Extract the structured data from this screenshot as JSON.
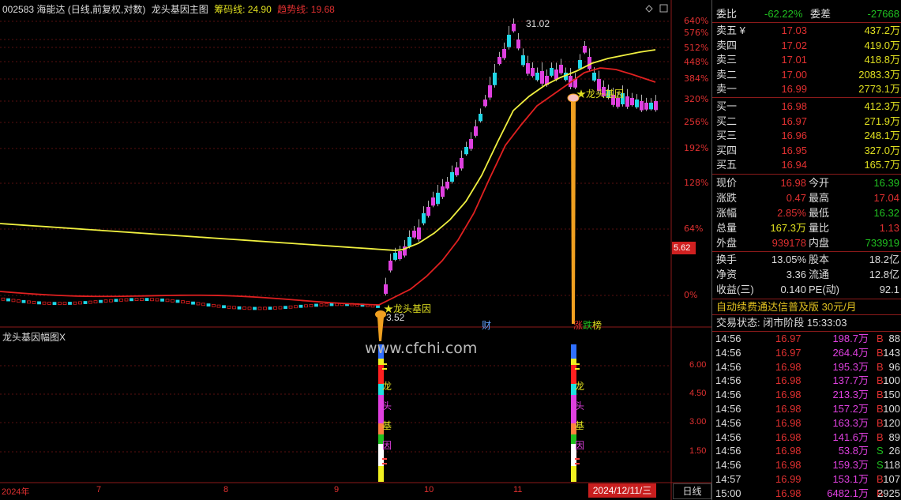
{
  "header": {
    "code_name": "002583 海能达 (日线,前复权,对数)",
    "indicator": "龙头基因主图",
    "chip_label": "筹码线: 24.90",
    "trend_label": "趋势线: 19.68"
  },
  "indicator_pane": {
    "title": "龙头基因幅图X"
  },
  "annotations": {
    "peak": "31.02",
    "low": "3.52",
    "gene1": "★龙头基因",
    "gene2": "★龙头基因",
    "cai": "财",
    "zhang": "涨",
    "die": "跌",
    "bang": "榜",
    "vchars": [
      "龙",
      "头",
      "基",
      "因"
    ]
  },
  "watermark": "www.cfchi.com",
  "y_axis": [
    "640%",
    "576%",
    "512%",
    "448%",
    "384%",
    "320%",
    "256%",
    "192%",
    "128%",
    "64%",
    "0%"
  ],
  "y_axis2": [
    "6.00",
    "4.50",
    "3.00",
    "1.50"
  ],
  "x_axis": [
    "2024年",
    "7",
    "8",
    "9",
    "10",
    "11"
  ],
  "current_price_tag": "5.62",
  "date_box": "2024/12/11/三",
  "period_button": "日线",
  "colors": {
    "up": "#e040e0",
    "down": "#20d8e8",
    "yellow": "#f0f040",
    "red": "#e02020"
  },
  "panel": {
    "weibi": {
      "label": "委比",
      "value": "-62.22%",
      "label2": "委差",
      "value2": "-27668"
    },
    "asks": [
      {
        "label": "卖五 ¥",
        "price": "17.03",
        "vol": "437.2万"
      },
      {
        "label": "卖四",
        "price": "17.02",
        "vol": "419.0万"
      },
      {
        "label": "卖三",
        "price": "17.01",
        "vol": "418.8万"
      },
      {
        "label": "卖二",
        "price": "17.00",
        "vol": "2083.3万"
      },
      {
        "label": "卖一",
        "price": "16.99",
        "vol": "2773.1万"
      }
    ],
    "bids": [
      {
        "label": "买一",
        "price": "16.98",
        "vol": "412.3万"
      },
      {
        "label": "买二",
        "price": "16.97",
        "vol": "271.9万"
      },
      {
        "label": "买三",
        "price": "16.96",
        "vol": "248.1万"
      },
      {
        "label": "买四",
        "price": "16.95",
        "vol": "327.0万"
      },
      {
        "label": "买五",
        "price": "16.94",
        "vol": "165.7万"
      }
    ],
    "quote": [
      {
        "l1": "现价",
        "v1": "16.98",
        "c1": "red",
        "l2": "今开",
        "v2": "16.39",
        "c2": "grn"
      },
      {
        "l1": "涨跌",
        "v1": "0.47",
        "c1": "red",
        "l2": "最高",
        "v2": "17.04",
        "c2": "red"
      },
      {
        "l1": "涨幅",
        "v1": "2.85%",
        "c1": "red",
        "l2": "最低",
        "v2": "16.32",
        "c2": "grn"
      },
      {
        "l1": "总量",
        "v1": "167.3万",
        "c1": "yel",
        "l2": "量比",
        "v2": "1.13",
        "c2": "red"
      },
      {
        "l1": "外盘",
        "v1": "939178",
        "c1": "red",
        "l2": "内盘",
        "v2": "733919",
        "c2": "grn"
      }
    ],
    "fundamentals": [
      {
        "l1": "换手",
        "v1": "13.05%",
        "l2": "股本",
        "v2": "18.2亿"
      },
      {
        "l1": "净资",
        "v1": "3.36",
        "l2": "流通",
        "v2": "12.8亿"
      },
      {
        "l1": "收益(三)",
        "v1": "0.140",
        "l2": "PE(动)",
        "v2": "92.1"
      }
    ],
    "promo": "自动续费通达信普及版  30元/月",
    "status": "交易状态: 闭市阶段 15:33:03",
    "ticks": [
      {
        "t": "14:56",
        "p": "16.97",
        "v": "198.7万",
        "d": "B",
        "n": "88"
      },
      {
        "t": "14:56",
        "p": "16.97",
        "v": "264.4万",
        "d": "B",
        "n": "143"
      },
      {
        "t": "14:56",
        "p": "16.98",
        "v": "195.3万",
        "d": "B",
        "n": "96"
      },
      {
        "t": "14:56",
        "p": "16.98",
        "v": "137.7万",
        "d": "B",
        "n": "100"
      },
      {
        "t": "14:56",
        "p": "16.98",
        "v": "213.3万",
        "d": "B",
        "n": "150"
      },
      {
        "t": "14:56",
        "p": "16.98",
        "v": "157.2万",
        "d": "B",
        "n": "100"
      },
      {
        "t": "14:56",
        "p": "16.98",
        "v": "163.3万",
        "d": "B",
        "n": "120"
      },
      {
        "t": "14:56",
        "p": "16.98",
        "v": "141.6万",
        "d": "B",
        "n": "89"
      },
      {
        "t": "14:56",
        "p": "16.98",
        "v": "53.8万",
        "d": "S",
        "n": "26"
      },
      {
        "t": "14:56",
        "p": "16.98",
        "v": "159.3万",
        "d": "S",
        "n": "118"
      },
      {
        "t": "14:57",
        "p": "16.99",
        "v": "153.1万",
        "d": "B",
        "n": "107"
      },
      {
        "t": "15:00",
        "p": "16.98",
        "v": "6482.1万",
        "d": "B",
        "n": "2925"
      }
    ]
  }
}
